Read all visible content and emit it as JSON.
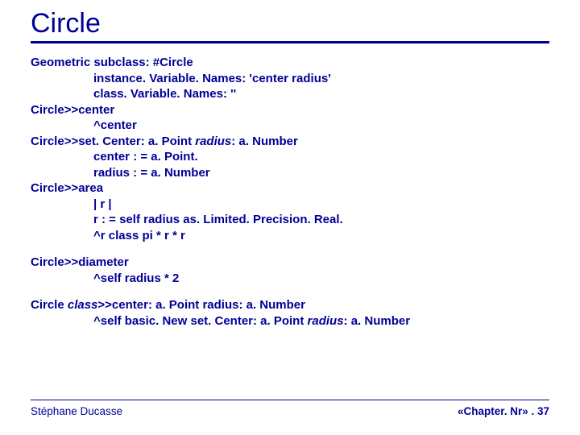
{
  "title": "Circle",
  "code": {
    "l1": "Geometric subclass: #Circle",
    "l2": "instance. Variable. Names: 'center radius'",
    "l3": "class. Variable. Names: ''",
    "l4": "Circle>>center",
    "l5": "^center",
    "l6a": "Circle>>set. Center: a. Point ",
    "l6b": "radius",
    "l6c": ": a. Number",
    "l7": "center : = a. Point.",
    "l8": "radius : = a. Number",
    "l9": "Circle>>area",
    "l10": "| r |",
    "l11": "r : = self radius as. Limited. Precision. Real.",
    "l12": "^r class pi * r * r",
    "l13": "Circle>>diameter",
    "l14": "^self radius * 2",
    "l15a": "Circle ",
    "l15b": "class",
    "l15c": ">>center: a. Point radius: a. Number",
    "l16a": "^self basic. New set. Center: a. Point ",
    "l16b": "radius",
    "l16c": ": a. Number"
  },
  "footer": {
    "author": "Stéphane Ducasse",
    "pager": "«Chapter. Nr» . 37"
  }
}
